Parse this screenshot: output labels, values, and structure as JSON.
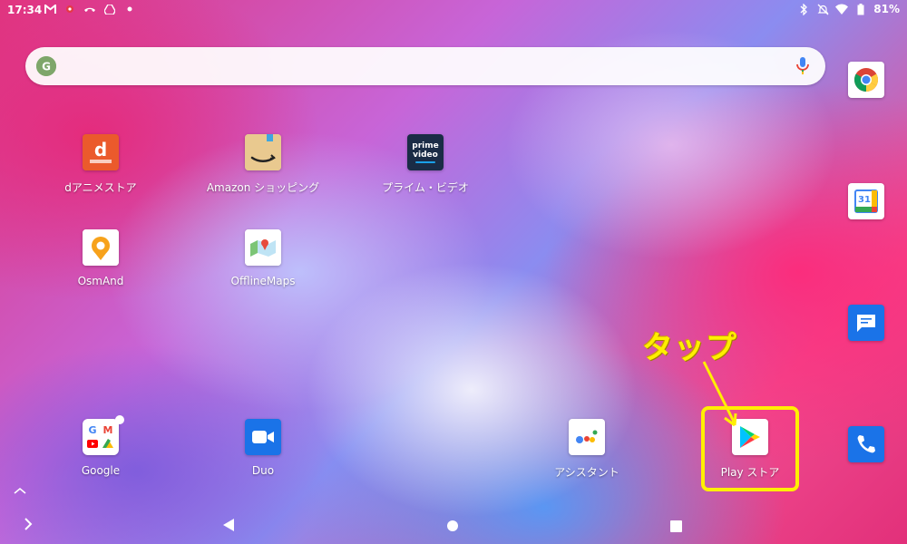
{
  "status_bar": {
    "time": "17:34",
    "battery": "81%",
    "left_icons": [
      "gmail-icon",
      "notification-dot-icon",
      "missed-call-icon",
      "drive-icon",
      "dot-icon"
    ],
    "right_icons": [
      "bluetooth-icon",
      "do-not-disturb-icon",
      "wifi-icon",
      "battery-icon"
    ]
  },
  "search_bar": {
    "placeholder": ""
  },
  "apps": {
    "danime": {
      "label": "dアニメストア",
      "icon": "danime-store-icon"
    },
    "amazon": {
      "label": "Amazon ショッピング",
      "icon": "amazon-shopping-icon"
    },
    "prime": {
      "label": "プライム・ビデオ",
      "icon": "prime-video-icon",
      "icon_text_1": "prime",
      "icon_text_2": "video"
    },
    "osmand": {
      "label": "OsmAnd",
      "icon": "osmand-icon"
    },
    "offlinemaps": {
      "label": "OfflineMaps",
      "icon": "offline-maps-icon"
    },
    "google": {
      "label": "Google",
      "icon": "google-folder-icon"
    },
    "duo": {
      "label": "Duo",
      "icon": "duo-icon"
    },
    "assistant": {
      "label": "アシスタント",
      "icon": "assistant-icon"
    },
    "playstore": {
      "label": "Play ストア",
      "icon": "play-store-icon"
    }
  },
  "dock": [
    "chrome-icon",
    "calendar-icon",
    "messages-icon",
    "phone-icon"
  ],
  "calendar_day": "31",
  "annotation": {
    "text": "タップ",
    "color": "#ffef00"
  },
  "nav": [
    "expand-icon",
    "back-icon",
    "home-icon",
    "recents-icon"
  ]
}
